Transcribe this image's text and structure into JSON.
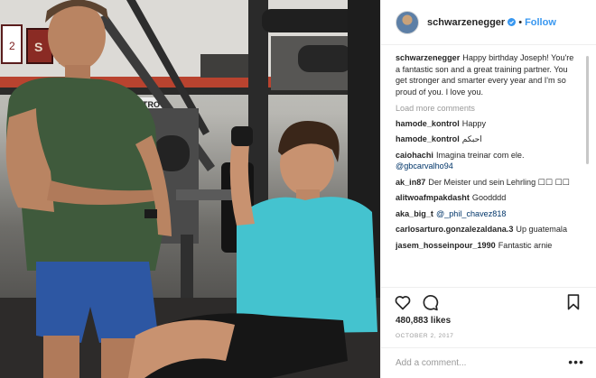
{
  "post": {
    "username": "schwarzenegger",
    "follow_label": "Follow",
    "separator": "•",
    "caption_user": "schwarzenegger",
    "caption_text": "Happy birthday Joseph! You're a fantastic son and a great training partner. You get stronger and smarter every year and I'm so proud of you. I love you.",
    "load_more": "Load more comments",
    "comments": [
      {
        "user": "hamode_kontrol",
        "text": "Happy"
      },
      {
        "user": "hamode_kontrol",
        "text": "احبكم"
      },
      {
        "user": "caiohachi",
        "text": "Imagina treinar com ele.",
        "mention": "@gbcarvalho94"
      },
      {
        "user": "ak_in87",
        "text": "Der Meister und sein Lehrling ☐☐ ☐☐"
      },
      {
        "user": "alitwoafmpakdasht",
        "text": "Goodddd"
      },
      {
        "user": "aka_big_t",
        "text": "",
        "mention": "@_phil_chavez818"
      },
      {
        "user": "carlosarturo.gonzalezaldana.3",
        "text": "Up guatemala"
      },
      {
        "user": "jasem_hosseinpour_1990",
        "text": "Fantastic arnie"
      }
    ],
    "likes": "480,883 likes",
    "date": "OCTOBER 2, 2017",
    "add_comment_placeholder": "Add a comment...",
    "more_options": "•••"
  },
  "photo": {
    "wall_signs": [
      "2",
      "S",
      "NITRO"
    ]
  },
  "icons": {
    "avatar": "avatar-image",
    "verified": "verified-badge-icon",
    "like": "heart-icon",
    "comment": "comment-bubble-icon",
    "save": "bookmark-icon",
    "more": "more-options-icon"
  },
  "colors": {
    "link_blue": "#3897f0",
    "verified_blue": "#3897f0",
    "muted_gray": "#999999",
    "text_dark": "#262626",
    "mention_blue": "#003569"
  }
}
